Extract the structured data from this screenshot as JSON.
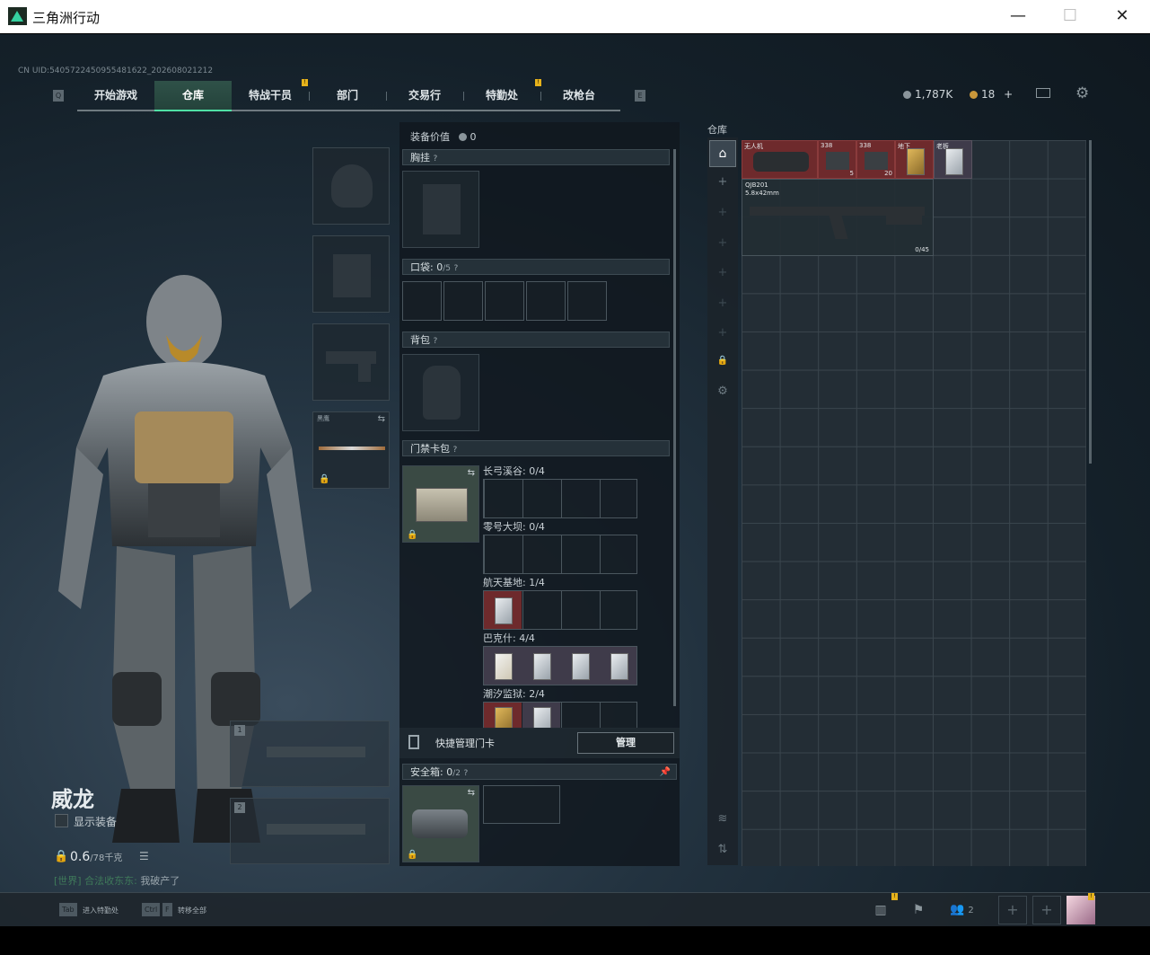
{
  "window": {
    "title": "三角洲行动",
    "minimize": "—",
    "maximize": "☐",
    "close": "✕"
  },
  "uid": "CN UID:5405722450955481622_202608021212",
  "nav": {
    "left_key": "Q",
    "right_key": "E",
    "tabs": [
      "开始游戏",
      "仓库",
      "特战干员",
      "部门",
      "交易行",
      "特勤处",
      "改枪台"
    ],
    "active_tab": "仓库",
    "badge_mark": "!"
  },
  "currency": {
    "money": "1,787K",
    "coupons": "18",
    "plus": "+"
  },
  "character": {
    "name": "威龙",
    "show_gear_label": "显示装备",
    "weight_current": "0.6",
    "weight_max": "/78千克",
    "chat_channel": "[世界]",
    "chat_user": "合法收东东:",
    "chat_msg": "我破产了"
  },
  "equip_slots": {
    "melee_label": "黑鹰",
    "weapon1_num": "1",
    "weapon2_num": "2"
  },
  "loadout": {
    "value_label": "装备价值",
    "value": "0",
    "chest_label": "胸挂",
    "pocket_label": "口袋:",
    "pocket_count": "0",
    "pocket_max": "/5",
    "backpack_label": "背包",
    "keycard_label": "门禁卡包",
    "help": "?",
    "maps": [
      {
        "name": "长弓溪谷: 0/4"
      },
      {
        "name": "零号大坝: 0/4"
      },
      {
        "name": "航天基地: 1/4"
      },
      {
        "name": "巴克什: 4/4"
      },
      {
        "name": "潮汐监狱: 2/4"
      }
    ],
    "quick_card_label": "快捷管理门卡",
    "manage_button": "管理",
    "safebox_label": "安全箱:",
    "safebox_count": "0",
    "safebox_max": "/2"
  },
  "warehouse": {
    "title": "仓库",
    "items": [
      {
        "label": "无人机"
      },
      {
        "label": "338",
        "count": "5"
      },
      {
        "label": "338",
        "count": "20"
      },
      {
        "label": "地下"
      },
      {
        "label": "老板"
      }
    ],
    "rifle_name": "QJB201",
    "rifle_caliber": "5.8x42mm",
    "rifle_ammo": "0/45"
  },
  "bottom_bar": {
    "key1": "Tab",
    "key1_label": "进入特勤处",
    "key2a": "Ctrl",
    "key2b": "F",
    "key2_label": "转移全部",
    "friends_count": "2"
  },
  "colors": {
    "accent": "#4fe0a5",
    "badge": "#e6b21b",
    "item_red": "#6e2a2c"
  }
}
